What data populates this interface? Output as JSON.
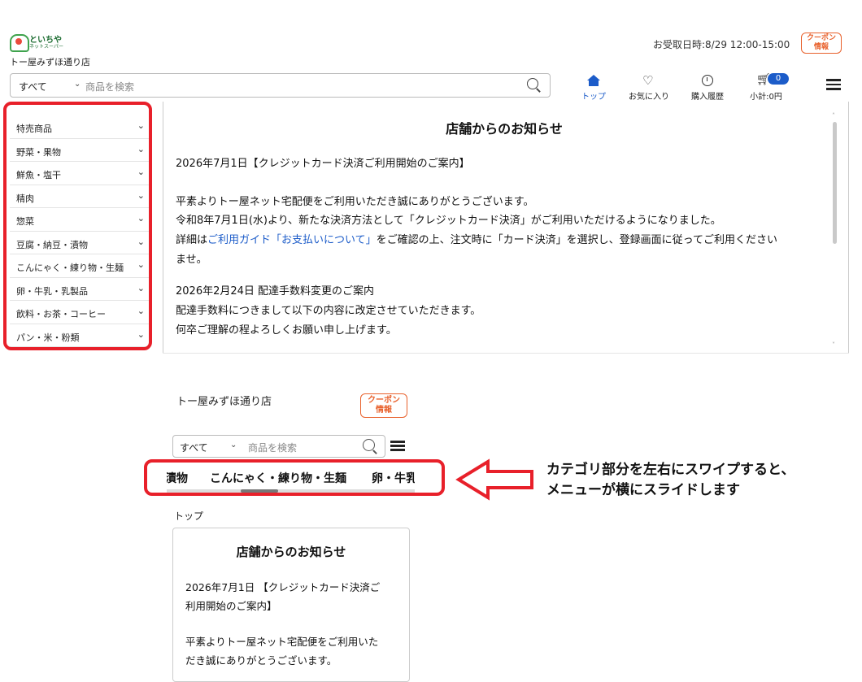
{
  "header": {
    "logo_text": "といちや",
    "logo_sub": "ネットスーパー",
    "store_name": "トー屋みずほ通り店",
    "pickup_label": "お受取日時:8/29 12:00-15:00",
    "coupon_label_1": "クーポン",
    "coupon_label_2": "情報"
  },
  "search": {
    "category": "すべて",
    "placeholder": "商品を検索"
  },
  "nav": {
    "top": "トップ",
    "favorites": "お気に入り",
    "history": "購入履歴",
    "cart_count": "0",
    "subtotal": "小計:0円"
  },
  "categories": [
    "特売商品",
    "野菜・果物",
    "鮮魚・塩干",
    "精肉",
    "惣菜",
    "豆腐・納豆・漬物",
    "こんにゃく・練り物・生麺",
    "卵・牛乳・乳製品",
    "飲料・お茶・コーヒー",
    "パン・米・粉類"
  ],
  "notice": {
    "title": "店舗からのお知らせ",
    "item1_heading": "2026年7月1日【クレジットカード決済ご利用開始のご案内】",
    "item1_line1": "平素よりトー屋ネット宅配便をご利用いただき誠にありがとうございます。",
    "item1_line2": "令和8年7月1日(水)より、新たな決済方法として「クレジットカード決済」がご利用いただけるようになりました。",
    "item1_line3_pre": "詳細は",
    "item1_line3_link": "ご利用ガイド「お支払いについて」",
    "item1_line3_post": "をご確認の上、注文時に「カード決済」を選択し、登録画面に従ってご利用ください",
    "item1_line4": "ませ。",
    "item2_heading": "2026年2月24日 配達手数料変更のご案内",
    "item2_line1": "配達手数料につきまして以下の内容に改定させていただきます。",
    "item2_line2": "何卒ご理解の程よろしくお願い申し上げます。"
  },
  "mobile": {
    "store_name": "トー屋みずほ通り店",
    "coupon_label_1": "クーポン",
    "coupon_label_2": "情報",
    "search_category": "すべて",
    "search_placeholder": "商品を検索",
    "cat_partial_left": "漬物",
    "cat_center": "こんにゃく・練り物・生麺",
    "cat_partial_right": "卵・牛乳",
    "swipe_note_line1": "カテゴリ部分を左右にスワイプすると、",
    "swipe_note_line2": "メニューが横にスライドします",
    "breadcrumb": "トップ",
    "card_title": "店舗からのお知らせ",
    "card_line1": "2026年7月1日 【クレジットカード決済ご",
    "card_line2": "利用開始のご案内】",
    "card_line3": "平素よりトー屋ネット宅配便をご利用いた",
    "card_line4": "だき誠にありがとうございます。"
  },
  "colors": {
    "accent_blue": "#1c5cc9",
    "highlight_red": "#e8202a",
    "coupon_orange": "#e8612c"
  }
}
